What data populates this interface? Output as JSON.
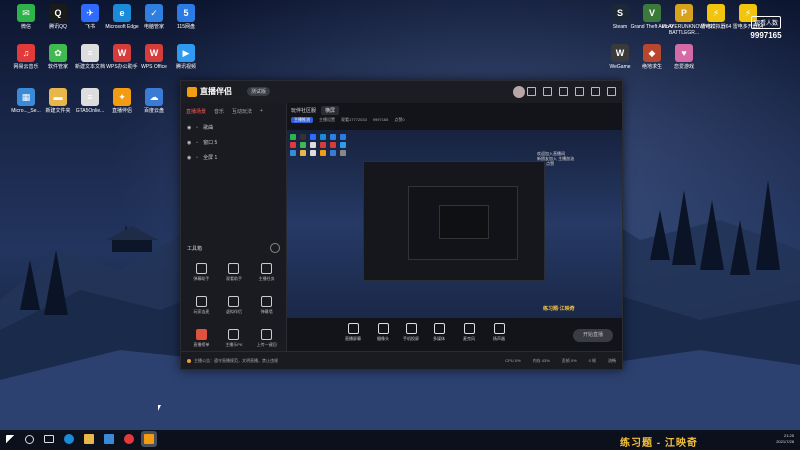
{
  "desktop_icons_left": [
    {
      "label": "微信",
      "color": "#2eb34b",
      "glyph": "✉"
    },
    {
      "label": "腾讯QQ",
      "color": "#1a1a1a",
      "glyph": "Q"
    },
    {
      "label": "飞书",
      "color": "#2f6bff",
      "glyph": "✈"
    },
    {
      "label": "Microsoft Edge",
      "color": "#1b8ad8",
      "glyph": "e"
    },
    {
      "label": "电脑管家",
      "color": "#2f7fe0",
      "glyph": "✓"
    },
    {
      "label": "115网盘",
      "color": "#2c7be5",
      "glyph": "5"
    },
    {
      "label": "网易云音乐",
      "color": "#e23a3a",
      "glyph": "♫"
    },
    {
      "label": "软件管家",
      "color": "#3fb950",
      "glyph": "✿"
    },
    {
      "label": "新建文本文档",
      "color": "#dddddd",
      "glyph": "≡"
    },
    {
      "label": "WPS办公助手",
      "color": "#d73c3c",
      "glyph": "W"
    },
    {
      "label": "WPS Office",
      "color": "#d73c3c",
      "glyph": "W"
    },
    {
      "label": "腾讯视频",
      "color": "#2e9af0",
      "glyph": "▶"
    },
    {
      "label": "Micro..._Se...",
      "color": "#3b8ad8",
      "glyph": "▦"
    },
    {
      "label": "新建文件夹",
      "color": "#e8b64a",
      "glyph": "▬"
    },
    {
      "label": "GTA5Onlie...",
      "color": "#dddddd",
      "glyph": "≡"
    },
    {
      "label": "直播伴侣",
      "color": "#f39c12",
      "glyph": "✦"
    },
    {
      "label": "百度云盘",
      "color": "#3a7bd5",
      "glyph": "☁"
    }
  ],
  "desktop_icons_right": [
    {
      "label": "Steam",
      "color": "#1b2838",
      "glyph": "S"
    },
    {
      "label": "Grand Theft Auto V",
      "color": "#3c7a3c",
      "glyph": "V"
    },
    {
      "label": "PLAYERUNKNOWN'S BATTLEGR...",
      "color": "#d7a21c",
      "glyph": "P"
    },
    {
      "label": "雷电模拟器64",
      "color": "#f1c40f",
      "glyph": "⚡"
    },
    {
      "label": "雷电多开器64",
      "color": "#f1c40f",
      "glyph": "⚡"
    },
    {
      "label": "WeGame",
      "color": "#3a3a3a",
      "glyph": "W"
    },
    {
      "label": "绝地求生",
      "color": "#b9472f",
      "glyph": "◆"
    },
    {
      "label": "恋爱游戏",
      "color": "#d46aa6",
      "glyph": "♥"
    }
  ],
  "viewer": {
    "label": "观看人数",
    "count": "9997165"
  },
  "app": {
    "name": "直播伴侣",
    "pill": "测试版",
    "left_tabs": [
      "直播场景",
      "音乐",
      "互动玩法"
    ],
    "sources": [
      {
        "label": "歌曲"
      },
      {
        "label": "窗口 5"
      },
      {
        "label": "全屏 1"
      }
    ],
    "toolbox_title": "工具箱",
    "tools": [
      {
        "label": "弹幕助手",
        "red": false
      },
      {
        "label": "观看助手",
        "red": false
      },
      {
        "label": "主播任务",
        "red": false
      },
      {
        "label": "玩家连麦",
        "red": false
      },
      {
        "label": "虚拟伴侣",
        "red": false
      },
      {
        "label": "弹幕墙",
        "red": false
      },
      {
        "label": "直播榜单",
        "red": true
      },
      {
        "label": "主播乐PK",
        "red": false
      },
      {
        "label": "上传一键回",
        "red": false
      }
    ],
    "scene_tabs": [
      "玩伴社区服",
      "横屏"
    ],
    "scene_info": [
      "主播推流",
      "主播设置",
      "观看17772033",
      "9997165",
      "点赞0"
    ],
    "overlay_text": [
      "欢迎加入直播间",
      "新朋友加入 主播加油",
      "关注 点赞"
    ],
    "bottom_controls": [
      "直播屏幕",
      "摄像头",
      "手机投屏",
      "多媒体",
      "麦克风",
      "扬声器"
    ],
    "start_live_label": "开始直播",
    "status_notice": "主播公告：遵守直播规范，文明直播，禁止违规",
    "status_stats": [
      "CPU 0%",
      "内存 43%",
      "丢帧 0%",
      "0 帧",
      "流畅"
    ],
    "preview_brand": "练习题·江映奇"
  },
  "taskbar": {
    "brand": "练习题 - 江映奇",
    "time": "21:25",
    "date": "2021/7/28"
  }
}
